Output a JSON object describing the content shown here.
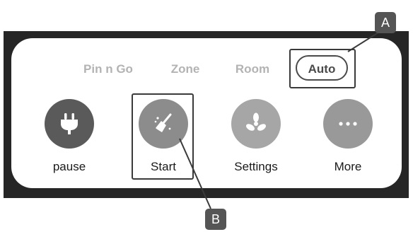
{
  "mode_tabs": {
    "pin_n_go": "Pin n Go",
    "zone": "Zone",
    "room": "Room",
    "auto": "Auto",
    "selected": "Auto"
  },
  "actions": {
    "pause": {
      "label": "pause",
      "icon": "plug-icon"
    },
    "start": {
      "label": "Start",
      "icon": "broom-icon"
    },
    "settings": {
      "label": "Settings",
      "icon": "fan-icon"
    },
    "more": {
      "label": "More",
      "icon": "ellipsis-icon"
    }
  },
  "callouts": {
    "a": "A",
    "b": "B"
  },
  "colors": {
    "frame": "#262626",
    "tab_inactive": "#b3b3b3",
    "tab_active": "#4a4a4a",
    "badge": "#555555"
  }
}
